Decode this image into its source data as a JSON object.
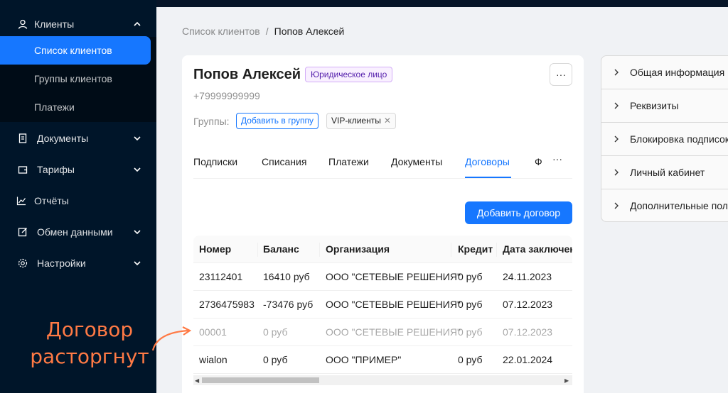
{
  "sidebar": {
    "clients": "Клиенты",
    "sub": [
      "Список клиентов",
      "Группы клиентов",
      "Платежи"
    ],
    "items": [
      "Документы",
      "Тарифы",
      "Отчёты",
      "Обмен данными",
      "Настройки"
    ]
  },
  "breadcrumb": {
    "prev": "Список клиентов",
    "sep": "/",
    "current": "Попов Алексей"
  },
  "client": {
    "name": "Попов Алексей",
    "type_tag": "Юридическое лицо",
    "phone": "+79999999999",
    "groups_label": "Группы:",
    "add_group": "Добавить в группу",
    "group_tag": "VIP-клиенты"
  },
  "tabs": [
    "Подписки",
    "Списания",
    "Платежи",
    "Документы",
    "Договоры",
    "Ф",
    "···"
  ],
  "add_contract": "Добавить договор",
  "table": {
    "columns": [
      "Номер",
      "Баланс",
      "Организация",
      "Кредит",
      "Дата заключения"
    ],
    "rows": [
      [
        "23112401",
        "16410 руб",
        "ООО \"СЕТЕВЫЕ РЕШЕНИЯ\"",
        "0 руб",
        "24.11.2023"
      ],
      [
        "2736475983",
        "-73476 руб",
        "ООО \"СЕТЕВЫЕ РЕШЕНИЯ\"",
        "0 руб",
        "07.12.2023"
      ],
      [
        "00001",
        "0 руб",
        "ООО \"СЕТЕВЫЕ РЕШЕНИЯ\"",
        "0 руб",
        "07.12.2023"
      ],
      [
        "wialon",
        "0 руб",
        "ООО \"ПРИМЕР\"",
        "0 руб",
        "22.01.2024"
      ]
    ]
  },
  "panel": [
    "Общая информация",
    "Реквизиты",
    "Блокировка подписок",
    "Личный кабинет",
    "Дополнительные поля"
  ],
  "annotation": {
    "line1": "Договор",
    "line2": "расторгнут"
  },
  "colors": {
    "accent": "#1677ff",
    "sidebar": "#001529",
    "annotation": "#ff7a45"
  }
}
